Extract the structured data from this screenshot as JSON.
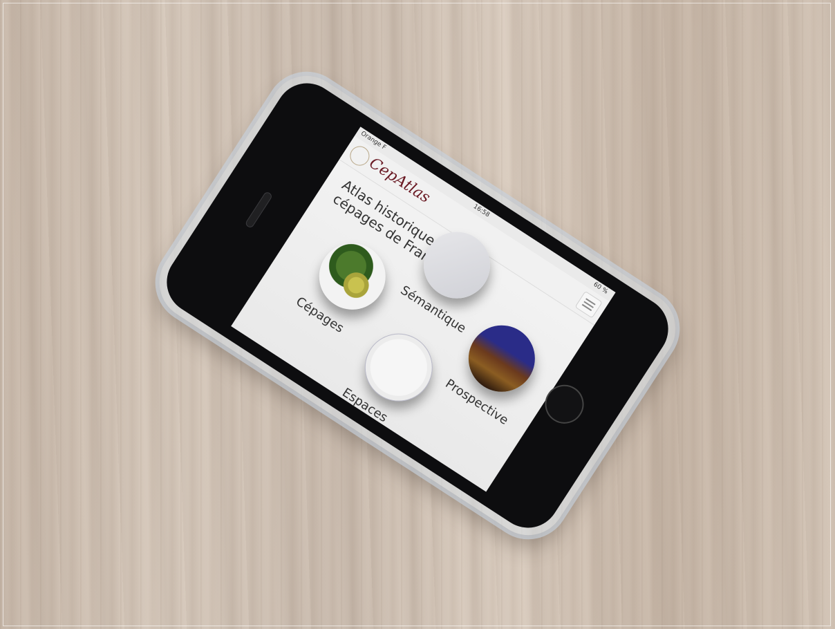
{
  "status_bar": {
    "carrier": "Orange F",
    "time": "16:58",
    "battery": "60 %"
  },
  "header": {
    "logo": "CepAtlas",
    "menu_icon": "hamburger-menu-icon"
  },
  "page": {
    "title": "Atlas historique des cépages de France"
  },
  "tiles": [
    {
      "label": "Cépages"
    },
    {
      "label": "Sémantique"
    },
    {
      "label": "Espaces"
    },
    {
      "label": "Prospective"
    }
  ]
}
